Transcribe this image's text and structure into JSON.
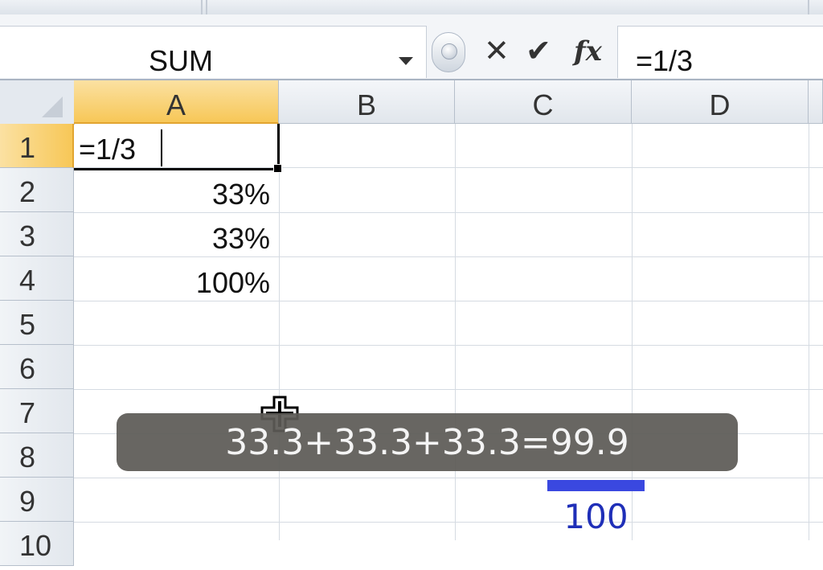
{
  "formula_bar": {
    "name_box": "SUM",
    "cancel_icon": "✕",
    "enter_icon": "✔",
    "fx_icon": "fx",
    "formula": "=1/3"
  },
  "columns": [
    "A",
    "B",
    "C",
    "D"
  ],
  "rows": [
    "1",
    "2",
    "3",
    "4",
    "5",
    "6",
    "7",
    "8",
    "9",
    "10"
  ],
  "cells": {
    "A1": "=1/3",
    "A2": "33%",
    "A3": "33%",
    "A4": "100%"
  },
  "caption": "33.3+33.3+33.3=99.9",
  "annotation": "100",
  "colors": {
    "selected_header": "#f7c757",
    "caption_bg": "#5c5a56",
    "annotation": "#3a48e0"
  },
  "icons": [
    "dropdown-arrow-icon",
    "cancel-icon",
    "enter-check-icon",
    "insert-function-icon",
    "crosshair-cursor-icon"
  ]
}
